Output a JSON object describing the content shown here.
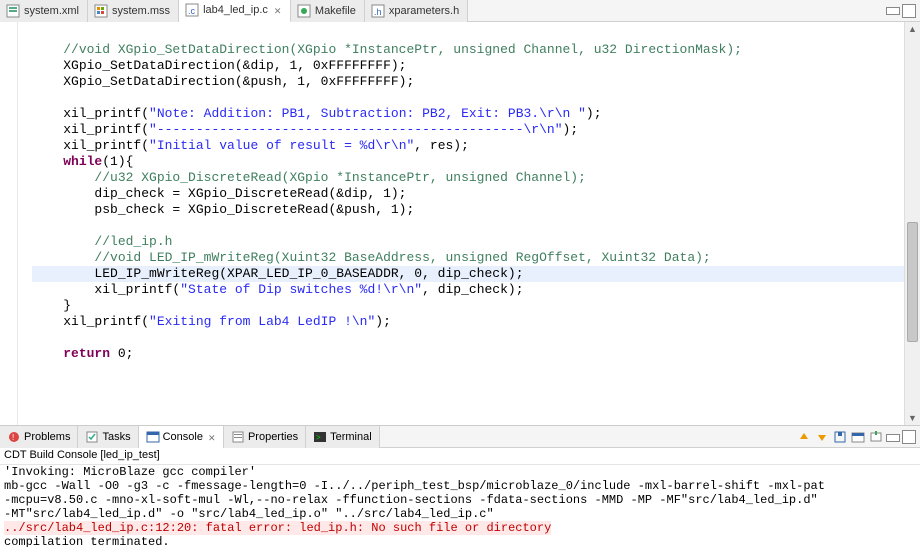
{
  "editor_tabs": [
    {
      "label": "system.xml",
      "icon": "xml"
    },
    {
      "label": "system.mss",
      "icon": "mss"
    },
    {
      "label": "lab4_led_ip.c",
      "icon": "c",
      "active": true
    },
    {
      "label": "Makefile",
      "icon": "make"
    },
    {
      "label": "xparameters.h",
      "icon": "h"
    }
  ],
  "code": {
    "l1_comment": "//void XGpio_SetDataDirection(XGpio *InstancePtr, unsigned Channel, u32 DirectionMask);",
    "l2a": "XGpio_SetDataDirection(&dip, 1, 0xFFFFFFFF);",
    "l3a": "XGpio_SetDataDirection(&push, 1, 0xFFFFFFFF);",
    "l5a": "xil_printf(",
    "l5s": "\"Note: Addition: PB1, Subtraction: PB2, Exit: PB3.\\r\\n \"",
    "l5b": ");",
    "l6a": "xil_printf(",
    "l6s": "\"-----------------------------------------------\\r\\n\"",
    "l6b": ");",
    "l7a": "xil_printf(",
    "l7s": "\"Initial value of result = %d\\r\\n\"",
    "l7b": ", res);",
    "l8k": "while",
    "l8a": "(1){",
    "l9_comment": "//u32 XGpio_DiscreteRead(XGpio *InstancePtr, unsigned Channel);",
    "l10a": "dip_check = XGpio_DiscreteRead(&dip, 1);",
    "l11a": "psb_check = XGpio_DiscreteRead(&push, 1);",
    "l13_comment": "//led_ip.h",
    "l14_comment": "//void LED_IP_mWriteReg(Xuint32 BaseAddress, unsigned RegOffset, Xuint32 Data);",
    "l15a": "LED_IP_mWriteReg(XPAR_LED_IP_0_BASEADDR, 0, dip_check);",
    "l16a": "xil_printf(",
    "l16s": "\"State of Dip switches %d!\\r\\n\"",
    "l16b": ", dip_check);",
    "l17a": "}",
    "l18a": "xil_printf(",
    "l18s": "\"Exiting from Lab4 LedIP !\\n\"",
    "l18b": ");",
    "l20k": "return",
    "l20a": " 0;"
  },
  "bottom_tabs": [
    {
      "label": "Problems",
      "icon": "problems"
    },
    {
      "label": "Tasks",
      "icon": "tasks"
    },
    {
      "label": "Console",
      "icon": "console",
      "active": true
    },
    {
      "label": "Properties",
      "icon": "props"
    },
    {
      "label": "Terminal",
      "icon": "terminal"
    }
  ],
  "console_title": "CDT Build Console [led_ip_test]",
  "console": {
    "l1": "'Invoking: MicroBlaze gcc compiler'",
    "l2": "mb-gcc -Wall -O0 -g3 -c -fmessage-length=0 -I../../periph_test_bsp/microblaze_0/include -mxl-barrel-shift -mxl-pat",
    "l3": "-mcpu=v8.50.c -mno-xl-soft-mul -Wl,--no-relax -ffunction-sections -fdata-sections -MMD -MP -MF\"src/lab4_led_ip.d\"",
    "l4": "-MT\"src/lab4_led_ip.d\" -o \"src/lab4_led_ip.o\" \"../src/lab4_led_ip.c\"",
    "l5": "../src/lab4_led_ip.c:12:20: fatal error: led_ip.h: No such file or directory",
    "l6": "compilation terminated."
  }
}
